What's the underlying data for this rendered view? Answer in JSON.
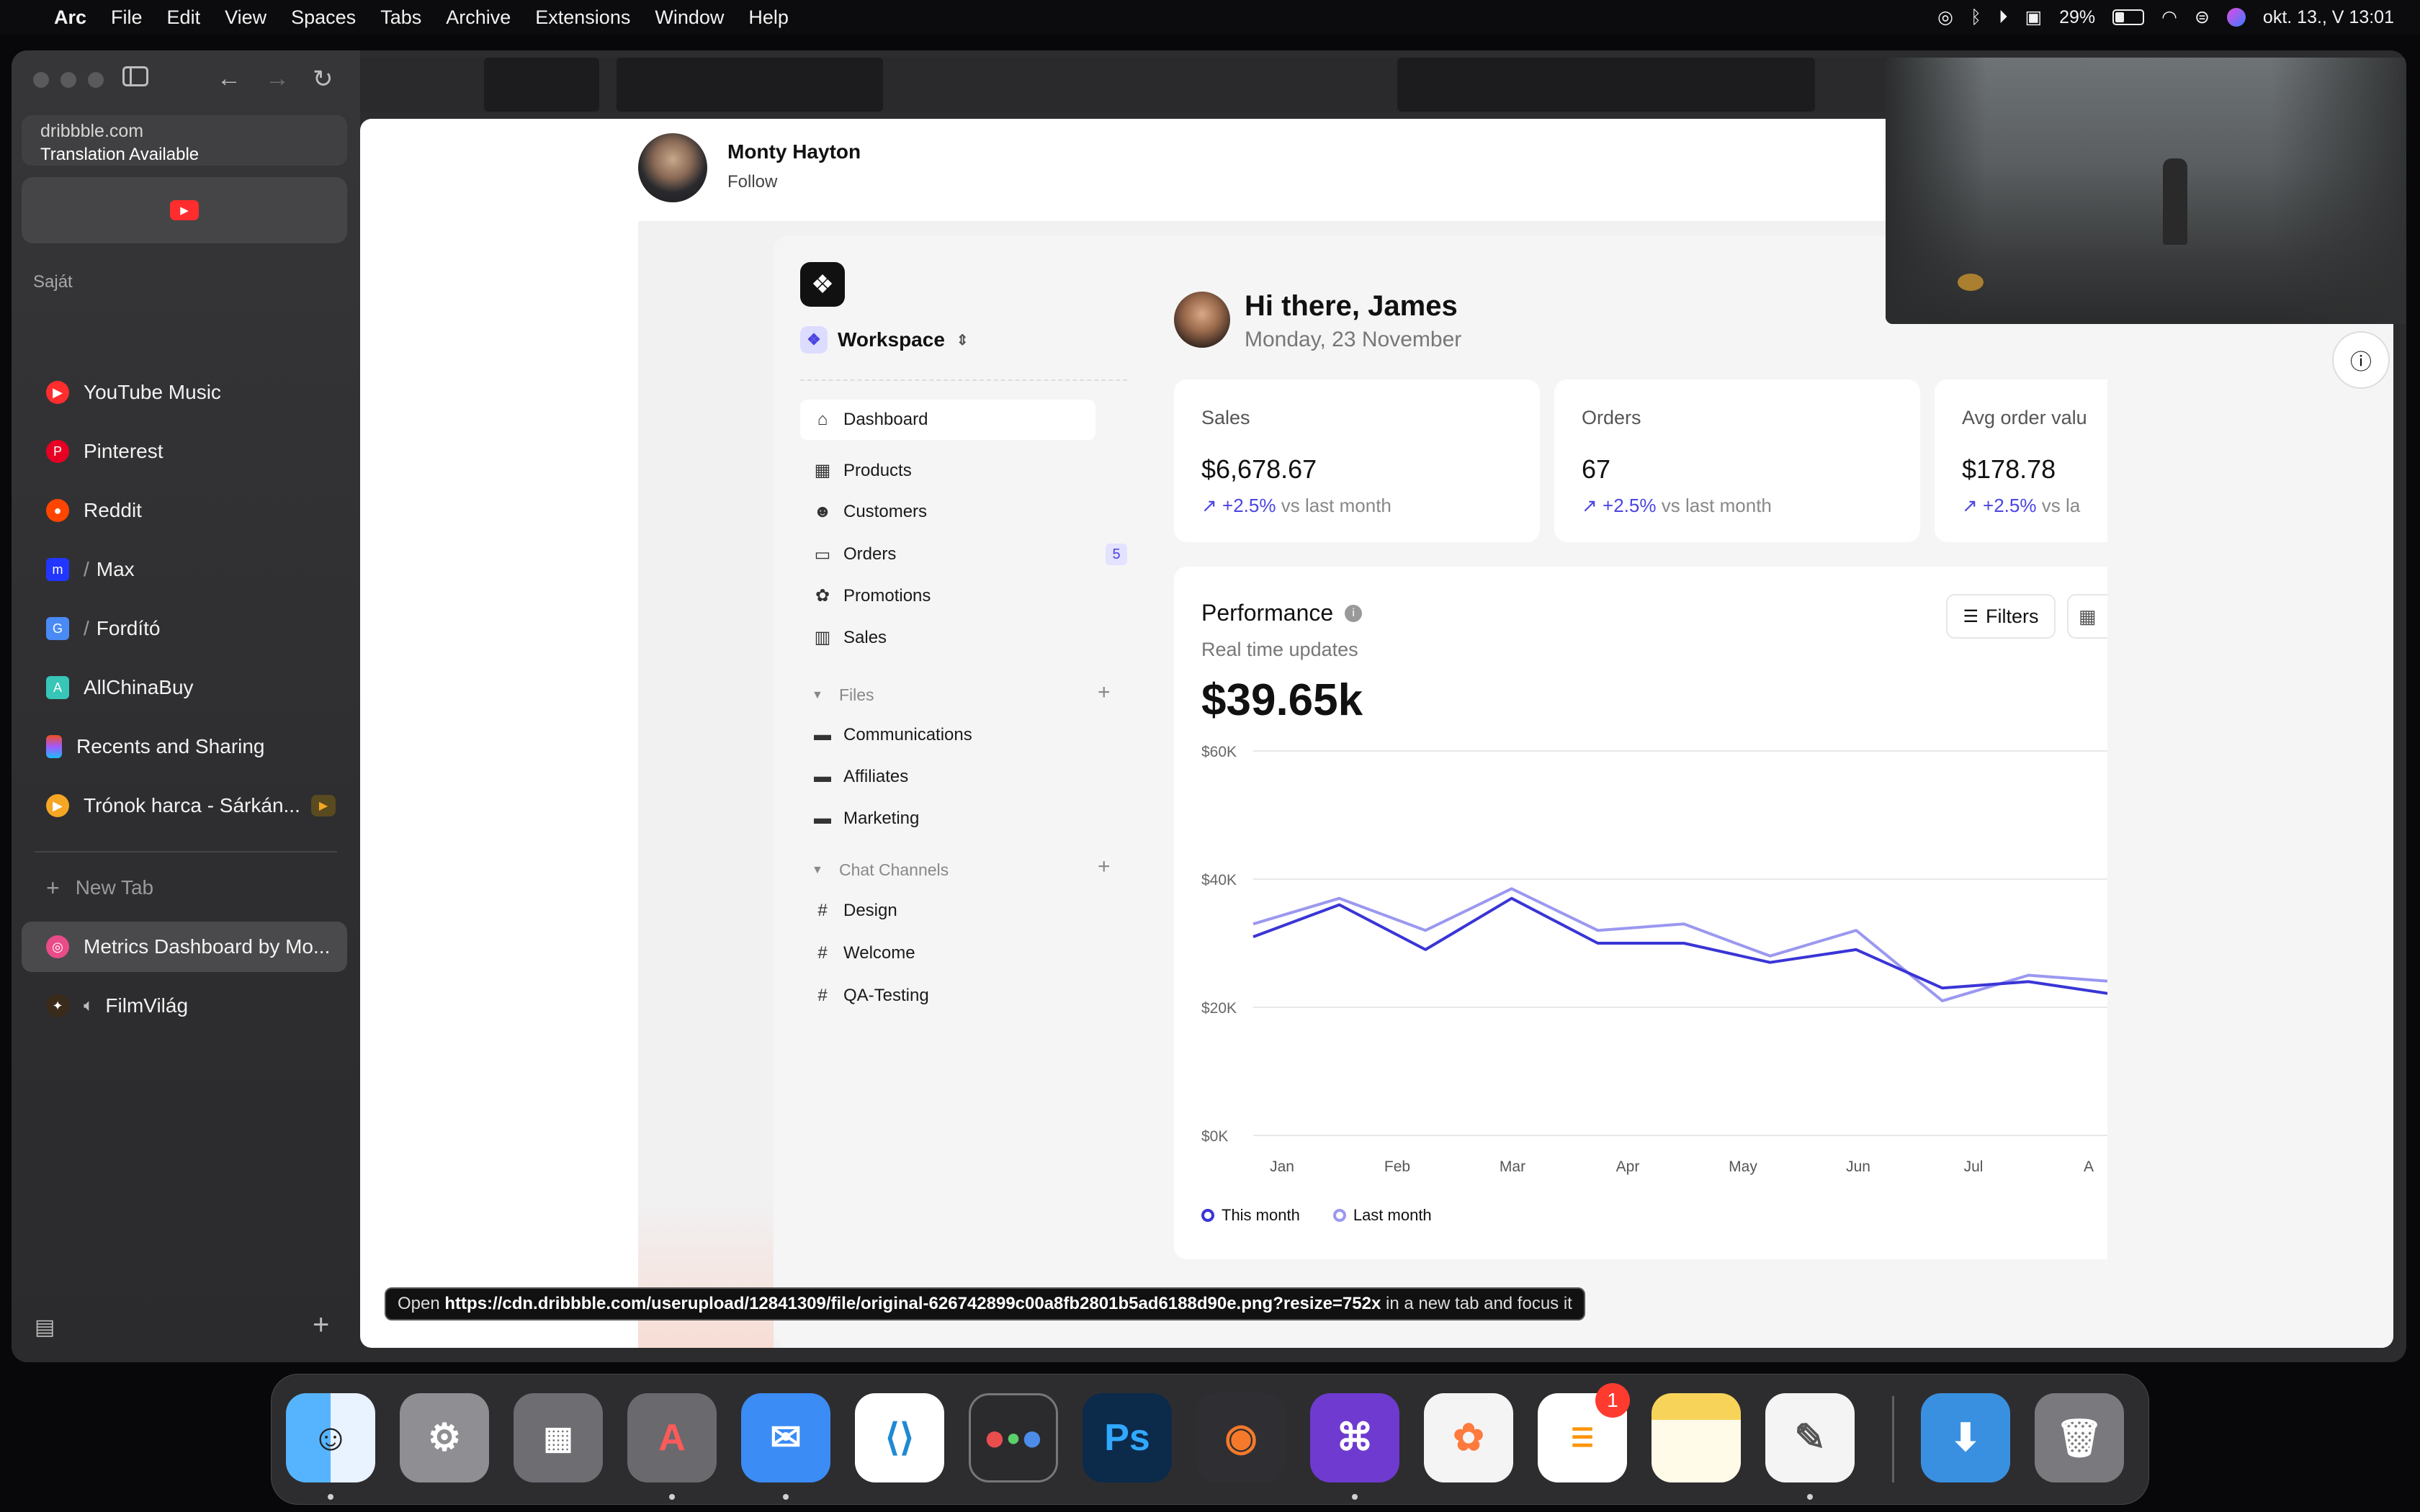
{
  "menubar": {
    "apple": "",
    "app": "Arc",
    "items": [
      "File",
      "Edit",
      "View",
      "Spaces",
      "Tabs",
      "Archive",
      "Extensions",
      "Window",
      "Help"
    ],
    "battery": "29%",
    "clock": "okt. 13., V  13:01"
  },
  "sidebar": {
    "url": "dribbble.com",
    "url_note": "Translation Available",
    "section": "Saját",
    "tabs": [
      {
        "label": "YouTube Music",
        "icon": "youtube-music-icon",
        "color": "#ff2d2d"
      },
      {
        "label": "Pinterest",
        "icon": "pinterest-icon",
        "color": "#e60023"
      },
      {
        "label": "Reddit",
        "icon": "reddit-icon",
        "color": "#ff4500"
      },
      {
        "label": "Max",
        "icon": "max-icon",
        "color": "#2136ff"
      },
      {
        "label": "Fordító",
        "icon": "translate-icon",
        "color": "#4a8af4"
      },
      {
        "label": "AllChinaBuy",
        "icon": "allchinabuy-icon",
        "color": "#37c6b8"
      },
      {
        "label": "Recents and Sharing",
        "icon": "figma-icon",
        "color": "#a259ff"
      },
      {
        "label": "Trónok harca - Sárkán...",
        "icon": "play-icon",
        "color": "#f5a623"
      }
    ],
    "new_tab": "New Tab",
    "active_tab": "Metrics Dashboard by Mo...",
    "last_tab": "FilmVilág"
  },
  "profile": {
    "name": "Monty Hayton",
    "follow": "Follow"
  },
  "dashboard": {
    "workspace": "Workspace",
    "nav": [
      "Dashboard",
      "Products",
      "Customers",
      "Orders",
      "Promotions",
      "Sales"
    ],
    "orders_badge": "5",
    "files_header": "Files",
    "files": [
      "Communications",
      "Affiliates",
      "Marketing"
    ],
    "chat_header": "Chat Channels",
    "channels": [
      "Design",
      "Welcome",
      "QA-Testing"
    ],
    "greeting": "Hi there, James",
    "date": "Monday, 23 November",
    "kpis": [
      {
        "label": "Sales",
        "value": "$6,678.67",
        "delta": "+2.5%",
        "note": "vs last month"
      },
      {
        "label": "Orders",
        "value": "67",
        "delta": "+2.5%",
        "note": "vs last month"
      },
      {
        "label": "Avg order valu",
        "value": "$178.78",
        "delta": "+2.5%",
        "note": "vs la"
      }
    ],
    "performance": {
      "title": "Performance",
      "subtitle": "Real time updates",
      "total": "$39.65k",
      "filters": "Filters"
    }
  },
  "chart_data": {
    "type": "line",
    "x": [
      "Jan",
      "",
      "Feb",
      "",
      "Mar",
      "",
      "Apr",
      "",
      "May",
      "",
      "Jun",
      "",
      "Jul",
      "",
      "A"
    ],
    "ylim": [
      0,
      60000
    ],
    "yticks": [
      "$60K",
      "$40K",
      "$20K",
      "$0K"
    ],
    "series": [
      {
        "name": "This month",
        "color": "#3a35d6",
        "values": [
          31000,
          36000,
          29000,
          37000,
          30000,
          30000,
          27000,
          29000,
          23000,
          24000,
          22000
        ]
      },
      {
        "name": "Last month",
        "color": "#9b98f0",
        "values": [
          33000,
          37000,
          32000,
          38500,
          32000,
          33000,
          28000,
          32000,
          21000,
          25000,
          24000
        ]
      }
    ]
  },
  "tooltip": {
    "prefix": "Open",
    "url": "https://cdn.dribbble.com/userupload/12841309/file/original-626742899c00a8fb2801b5ad6188d90e.png?resize=752x",
    "suffix": "in a new tab and focus it"
  },
  "dock": [
    {
      "name": "Finder",
      "color": "#2f8cf0"
    },
    {
      "name": "System Settings",
      "color": "#8e8e93"
    },
    {
      "name": "Launchpad",
      "color": "#6d6d72"
    },
    {
      "name": "Affinity",
      "color": "#6a6a6e"
    },
    {
      "name": "Mail",
      "color": "#3b8cf5"
    },
    {
      "name": "VS Code",
      "color": "#1f8ad2"
    },
    {
      "name": "DaVinci Resolve",
      "color": "#2b2b2e"
    },
    {
      "name": "Photoshop",
      "color": "#0c2a4a"
    },
    {
      "name": "Blender",
      "color": "#2f2f33"
    },
    {
      "name": "GitHub Desktop",
      "color": "#6f3ad0"
    },
    {
      "name": "Photos",
      "color": "#f4f4f4"
    },
    {
      "name": "Reminders",
      "color": "#ffffff"
    },
    {
      "name": "Notes",
      "color": "#f7d35a"
    },
    {
      "name": "TextEdit",
      "color": "#f4f4f4"
    },
    {
      "name": "Downloads",
      "color": "#3a90e0"
    },
    {
      "name": "Trash",
      "color": "#7a7a7e"
    }
  ],
  "reminders_badge": "1"
}
